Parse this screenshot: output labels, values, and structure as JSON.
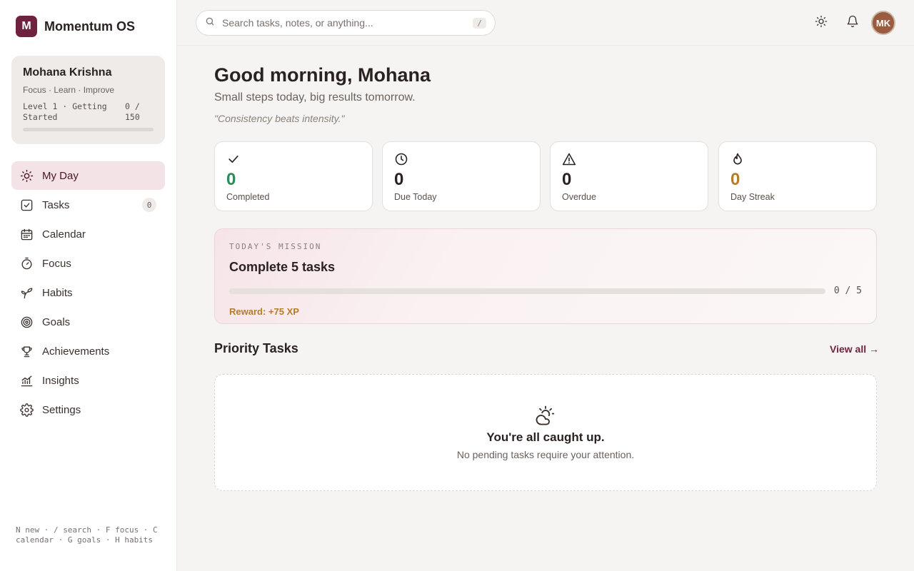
{
  "brand": {
    "logo_letter": "M",
    "name": "Momentum OS",
    "accent": "#6e2240"
  },
  "profile": {
    "name": "Mohana Krishna",
    "tagline": "Focus · Learn · Improve",
    "level_text": "Level 1 · Getting Started",
    "xp_text": "0 / 150",
    "xp_progress": 0
  },
  "sidebar": {
    "items": [
      {
        "label": "My Day",
        "icon": "sun-icon",
        "active": true
      },
      {
        "label": "Tasks",
        "icon": "checkbox-icon",
        "badge": "0"
      },
      {
        "label": "Calendar",
        "icon": "calendar-icon"
      },
      {
        "label": "Focus",
        "icon": "timer-icon"
      },
      {
        "label": "Habits",
        "icon": "sprout-icon"
      },
      {
        "label": "Goals",
        "icon": "target-icon"
      },
      {
        "label": "Achievements",
        "icon": "trophy-icon"
      },
      {
        "label": "Insights",
        "icon": "chart-icon"
      },
      {
        "label": "Settings",
        "icon": "gear-icon"
      }
    ],
    "shortcuts": "N new · / search · F focus · C calendar · G goals · H habits"
  },
  "topbar": {
    "search_placeholder": "Search tasks, notes, or anything...",
    "search_shortcut": "/",
    "avatar_initials": "MK"
  },
  "header": {
    "greeting": "Good morning, Mohana",
    "subtitle": "Small steps today, big results tomorrow.",
    "quote": "\"Consistency beats intensity.\""
  },
  "stats": [
    {
      "value": "0",
      "label": "Completed",
      "icon": "check-icon",
      "color": "#2e8b57"
    },
    {
      "value": "0",
      "label": "Due Today",
      "icon": "clock-icon",
      "color": "#2a2220"
    },
    {
      "value": "0",
      "label": "Overdue",
      "icon": "warning-icon",
      "color": "#2a2220"
    },
    {
      "value": "0",
      "label": "Day Streak",
      "icon": "flame-icon",
      "color": "#b57c2b"
    }
  ],
  "mission": {
    "kicker": "TODAY'S MISSION",
    "title": "Complete 5 tasks",
    "progress_text": "0 / 5",
    "progress": 0,
    "reward": "Reward: +75 XP"
  },
  "priority": {
    "title": "Priority Tasks",
    "view_all": "View all →",
    "empty_title": "You're all caught up.",
    "empty_subtitle": "No pending tasks require your attention.",
    "empty_icon": "cloud-sun-icon"
  }
}
